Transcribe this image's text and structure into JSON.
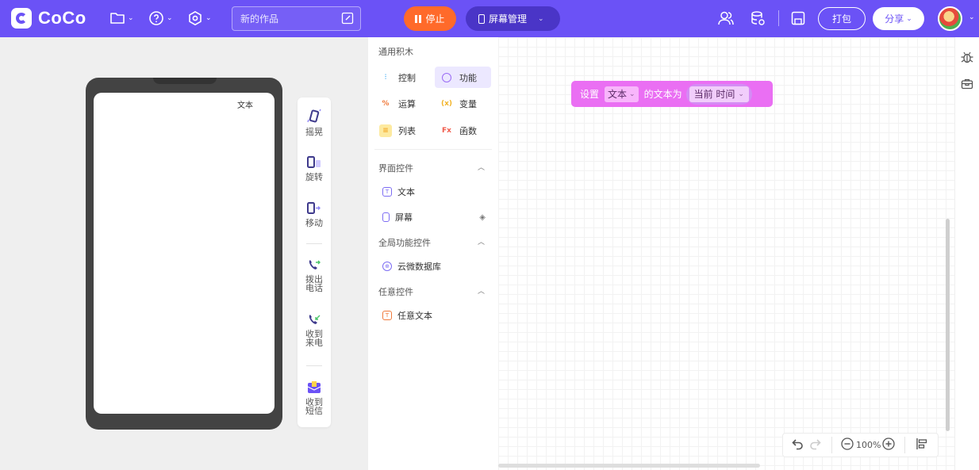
{
  "header": {
    "brand": "CoCo",
    "title_placeholder": "新的作品",
    "stop_label": "停止",
    "screen_manage_label": "屏幕管理",
    "pack_label": "打包",
    "share_label": "分享",
    "accent_color": "#6b52f6",
    "stop_color": "#ff6a2a"
  },
  "stage": {
    "screen_text": "文本",
    "sensors": [
      {
        "label": "摇晃",
        "icon": "shake-icon"
      },
      {
        "label": "旋转",
        "icon": "rotate-icon"
      },
      {
        "label": "移动",
        "icon": "move-icon"
      },
      {
        "label": "拨出电话",
        "icon": "call-out-icon"
      },
      {
        "label": "收到来电",
        "icon": "call-in-icon"
      },
      {
        "label": "收到短信",
        "icon": "sms-icon"
      }
    ]
  },
  "palette": {
    "title": "通用积木",
    "categories": [
      {
        "label": "控制",
        "icon": "control-icon",
        "color": "#2aa3f4"
      },
      {
        "label": "功能",
        "icon": "function-icon",
        "color": "#9b6cf5"
      },
      {
        "label": "运算",
        "icon": "operator-icon",
        "color": "#f07a3c"
      },
      {
        "label": "变量",
        "icon": "variable-icon",
        "color": "#f2b42a"
      },
      {
        "label": "列表",
        "icon": "list-icon",
        "color": "#f2c52a"
      },
      {
        "label": "函数",
        "icon": "fx-icon",
        "color": "#f05a4a"
      }
    ],
    "sections": [
      {
        "title": "界面控件",
        "items": [
          "文本",
          "屏幕"
        ]
      },
      {
        "title": "全局功能控件",
        "items": [
          "云微数据库"
        ]
      },
      {
        "title": "任意控件",
        "items": [
          "任意文本"
        ]
      }
    ]
  },
  "workspace": {
    "block": {
      "prefix": "设置",
      "target": "文本",
      "middle": "的文本为",
      "value": "当前 时间"
    },
    "zoom": "100%"
  }
}
